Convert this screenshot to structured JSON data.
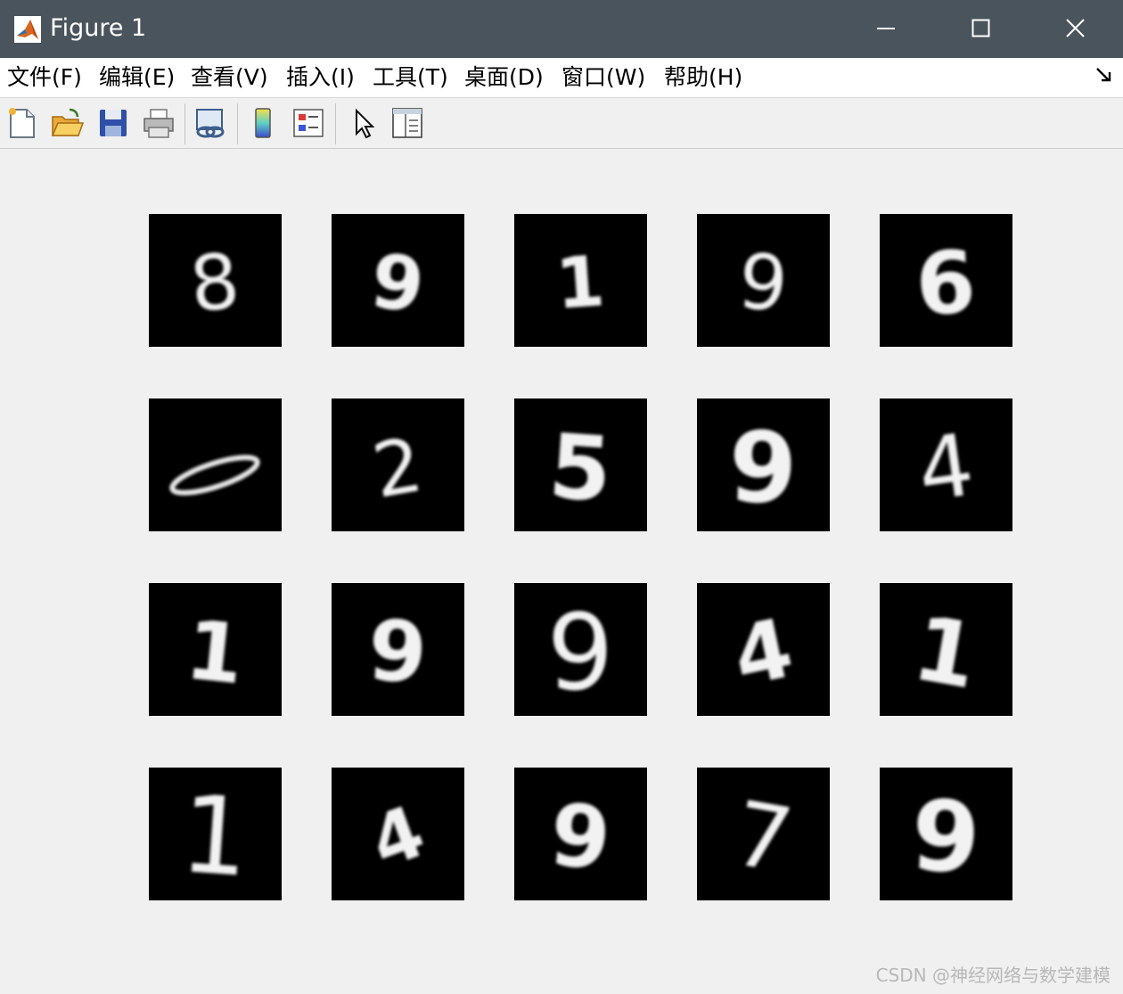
{
  "window": {
    "title": "Figure 1"
  },
  "menubar": {
    "items": [
      "文件(F)",
      "编辑(E)",
      "查看(V)",
      "插入(I)",
      "工具(T)",
      "桌面(D)",
      "窗口(W)",
      "帮助(H)"
    ]
  },
  "toolbar": {
    "buttons": [
      {
        "icon": "new-figure-icon"
      },
      {
        "icon": "open-file-icon"
      },
      {
        "icon": "save-icon"
      },
      {
        "icon": "print-icon"
      },
      {
        "icon": "link-plot-icon"
      },
      {
        "icon": "colorbar-icon"
      },
      {
        "icon": "legend-icon"
      },
      {
        "icon": "edit-plot-arrow-icon"
      },
      {
        "icon": "property-editor-icon"
      }
    ]
  },
  "figure": {
    "rows": 4,
    "cols": 5,
    "digits": [
      "8",
      "9",
      "1",
      "9",
      "6",
      "0",
      "2",
      "5",
      "9",
      "4",
      "1",
      "9",
      "9",
      "4",
      "1",
      "1",
      "4",
      "9",
      "7",
      "9"
    ]
  },
  "watermark": "CSDN @神经网络与数学建模"
}
